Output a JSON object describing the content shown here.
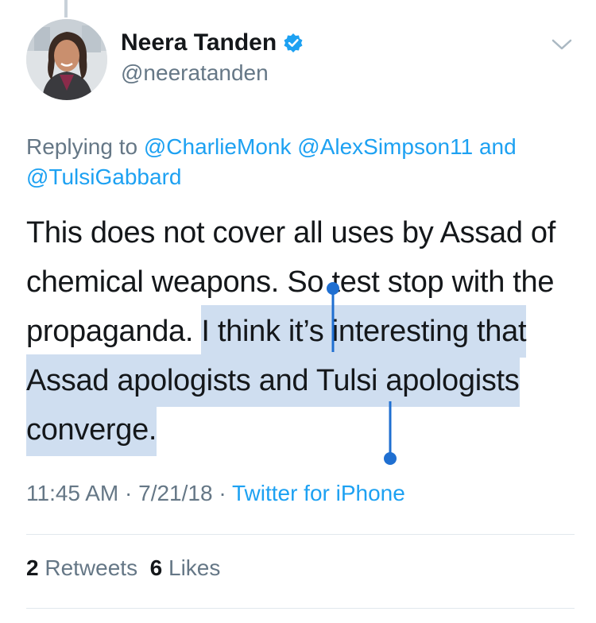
{
  "tweet": {
    "author_name": "Neera Tanden",
    "author_handle": "@neeratanden",
    "reply_prefix": "Replying to ",
    "reply_mentions": [
      "@CharlieMonk",
      "@AlexSimpson11",
      "@TulsiGabbard"
    ],
    "reply_join": " and ",
    "text_part1": "This does not cover all uses by Assad of chemical weapons. So test stop with the propaganda. ",
    "text_selected_line1": "I think it’s",
    "text_selected_rest": "interesting that Assad apologists and Tulsi apologists converge.",
    "time": "11:45 AM",
    "date": "7/21/18",
    "source": "Twitter for iPhone",
    "retweets_count": "2",
    "retweets_label": "Retweets",
    "likes_count": "6",
    "likes_label": "Likes"
  },
  "colors": {
    "link": "#1da1f2",
    "muted": "#657786",
    "text": "#14171a",
    "selection": "#cfdef0",
    "selection_handle": "#1f6fd1"
  },
  "icons": {
    "verified": "verified-badge-icon",
    "menu": "chevron-down-icon"
  }
}
